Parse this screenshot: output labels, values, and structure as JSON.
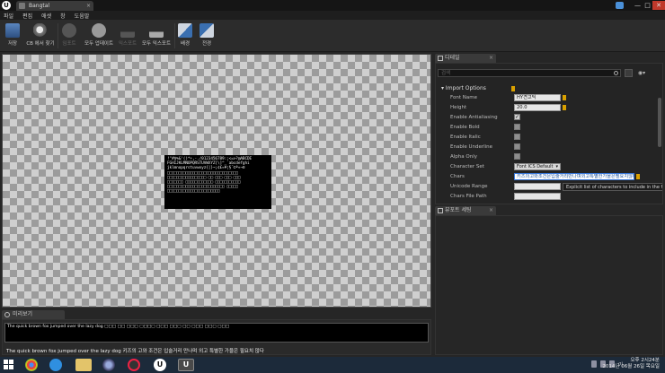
{
  "window": {
    "tab_title": "Bangtal",
    "minimize": "—",
    "maximize": "□",
    "close": "✕",
    "tab_close": "×"
  },
  "menu": [
    "파일",
    "편집",
    "애셋",
    "창",
    "도움말"
  ],
  "toolbar": {
    "buttons": [
      {
        "label": "저장",
        "icon": "save-icon",
        "enabled": true
      },
      {
        "label": "CB 에서 찾기",
        "icon": "find-in-cb-icon",
        "enabled": true
      },
      {
        "label": "임포트",
        "icon": "reimport-icon",
        "enabled": false
      },
      {
        "label": "모두 업데이트",
        "icon": "update-all-icon",
        "enabled": true
      },
      {
        "label": "익스포트",
        "icon": "export-icon",
        "enabled": false
      },
      {
        "label": "모두 익스포트",
        "icon": "export-all-icon",
        "enabled": true
      },
      {
        "label": "배경",
        "icon": "background-icon",
        "enabled": true
      },
      {
        "label": "전경",
        "icon": "foreground-icon",
        "enabled": true
      }
    ]
  },
  "atlas_lines": [
    "!\"#$%&'()*+,-./0123456789:;<=>?@ABCDE",
    "FGHIJKLMNOPQRSTUVWXYZ[\\]^_`abcdefghi",
    "jklmnopqrstuvwxyz{|}~¡¢£¤¥¦§¨©ª«¬­®",
    "□□□□□□□□□□□□□□□□□□□□□□□□□□□□□□□",
    "□□□□□□□□□□□□□□□□□ □□ □□□ □□□ □□□",
    "□□□□□□□ □□□□□□□□□□□□ □□□□□□□□□□□",
    "□□□□□□□□□□□□□□□□□□□□□□□□□ □□□□□",
    "□□□□□□□□□□□□□□□□□□□□□□□"
  ],
  "preview": {
    "tab_label": "미리보기",
    "input_value": "The quick brown fox jumped over the lazy dog □□□ □□ □□□ □□□□ □□□ □□□ □□ □□□ □□□ □□□",
    "preview_text": "The quick brown fox jumped over the lazy dog 키즈의 고와 조건은 입술거리 만나며 외고 특별한 가을은 필요치 않다"
  },
  "details": {
    "tab_label": "디테일",
    "search_placeholder": "검색",
    "category": "Import Options",
    "font_name_label": "Font Name",
    "font_name_value": "HY견고딕",
    "height_label": "Height",
    "height_value": "20.0",
    "antialias_label": "Enable Antialiasing",
    "antialias_checked": true,
    "bold_label": "Enable Bold",
    "bold_checked": false,
    "italic_label": "Enable Italic",
    "italic_checked": false,
    "underline_label": "Enable Underline",
    "underline_checked": false,
    "alpha_label": "Alpha Only",
    "alpha_checked": false,
    "charset_label": "Character Set",
    "charset_value": "Font ICS Default",
    "chars_label": "Chars",
    "chars_value": "키즈의고와조건은입술거리만나며외고특별한가을은필요치않다",
    "unicode_label": "Unicode Range",
    "unicode_value": "",
    "chars_file_label": "Chars File Path",
    "chars_file_value": "",
    "tooltip": "Explicit list of characters to include in the font"
  },
  "viewport_settings": {
    "tab_label": "뷰포트 세팅"
  },
  "taskbar": {
    "time": "오후 2시24분",
    "date": "2014년 06월 26일 목요일",
    "ime": "가"
  }
}
